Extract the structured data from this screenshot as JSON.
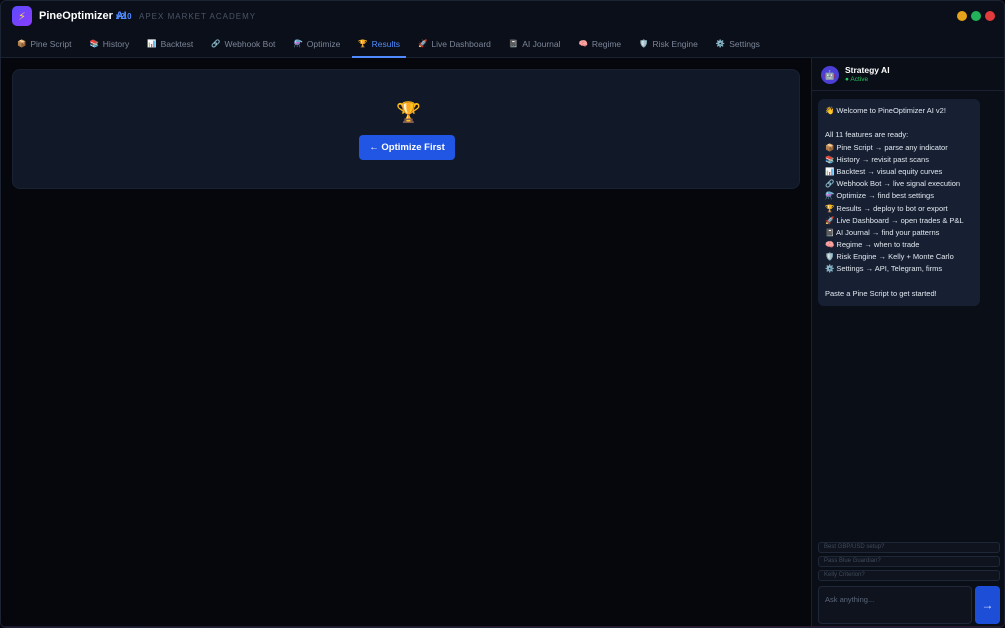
{
  "app": {
    "logo_glyph": "⚡",
    "name": "PineOptimizer",
    "name_ai": "AI",
    "version": "v2.0",
    "subtitle": "APEX MARKET ACADEMY"
  },
  "window_controls": [
    "minimize",
    "maximize",
    "close"
  ],
  "tabs": [
    {
      "icon": "📦",
      "label": "Pine Script"
    },
    {
      "icon": "📚",
      "label": "History"
    },
    {
      "icon": "📊",
      "label": "Backtest"
    },
    {
      "icon": "🔗",
      "label": "Webhook Bot"
    },
    {
      "icon": "⚗️",
      "label": "Optimize"
    },
    {
      "icon": "🏆",
      "label": "Results"
    },
    {
      "icon": "🚀",
      "label": "Live Dashboard"
    },
    {
      "icon": "📓",
      "label": "AI Journal"
    },
    {
      "icon": "🧠",
      "label": "Regime"
    },
    {
      "icon": "🛡️",
      "label": "Risk Engine"
    },
    {
      "icon": "⚙️",
      "label": "Settings"
    }
  ],
  "active_tab": "Results",
  "main": {
    "trophy_icon": "🏆",
    "optimize_first_label": "← Optimize First"
  },
  "chat": {
    "avatar_icon": "🤖",
    "bot_name": "Strategy AI",
    "status": "● Active",
    "message_lines": [
      "👋 Welcome to PineOptimizer AI v2!",
      "",
      "All 11 features are ready:",
      "📦 Pine Script → parse any indicator",
      "📚 History → revisit past scans",
      "📊 Backtest → visual equity curves",
      "🔗 Webhook Bot → live signal execution",
      "⚗️ Optimize → find best settings",
      "🏆 Results → deploy to bot or export",
      "🚀 Live Dashboard → open trades & P&L",
      "📓 AI Journal → find your patterns",
      "🧠 Regime → when to trade",
      "🛡️ Risk Engine → Kelly + Monte Carlo",
      "⚙️ Settings → API, Telegram, firms",
      "",
      "Paste a Pine Script to get started!"
    ],
    "suggestions": [
      "Best GBP/USD setup?",
      "Pass Blue Guardian?",
      "Kelly Criterion?"
    ],
    "input_placeholder": "Ask anything...",
    "send_glyph": "→"
  },
  "colors": {
    "accent": "#4f8bff",
    "button": "#2156e4",
    "status_active": "#22c55e",
    "bg": "#05070d",
    "panel": "#111827"
  }
}
